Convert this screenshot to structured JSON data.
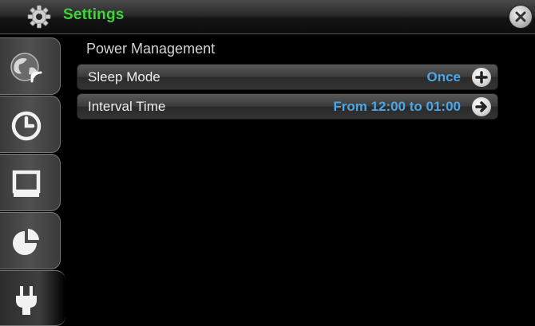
{
  "header": {
    "title": "Settings",
    "icon": "gear-icon",
    "close_icon": "close-icon"
  },
  "sidebar": {
    "tabs": [
      {
        "icon": "network-globe-icon",
        "active": false
      },
      {
        "icon": "clock-icon",
        "active": false
      },
      {
        "icon": "display-icon",
        "active": false
      },
      {
        "icon": "pie-chart-icon",
        "active": false
      },
      {
        "icon": "power-plug-icon",
        "active": true
      }
    ]
  },
  "main": {
    "section_title": "Power Management",
    "rows": [
      {
        "label": "Sleep Mode",
        "value": "Once",
        "action_icon": "plus-icon"
      },
      {
        "label": "Interval Time",
        "value": "From 12:00 to 01:00",
        "action_icon": "arrow-right-icon"
      }
    ]
  },
  "colors": {
    "title": "#3fd33a",
    "value": "#4aa6e6",
    "background": "#000000"
  }
}
